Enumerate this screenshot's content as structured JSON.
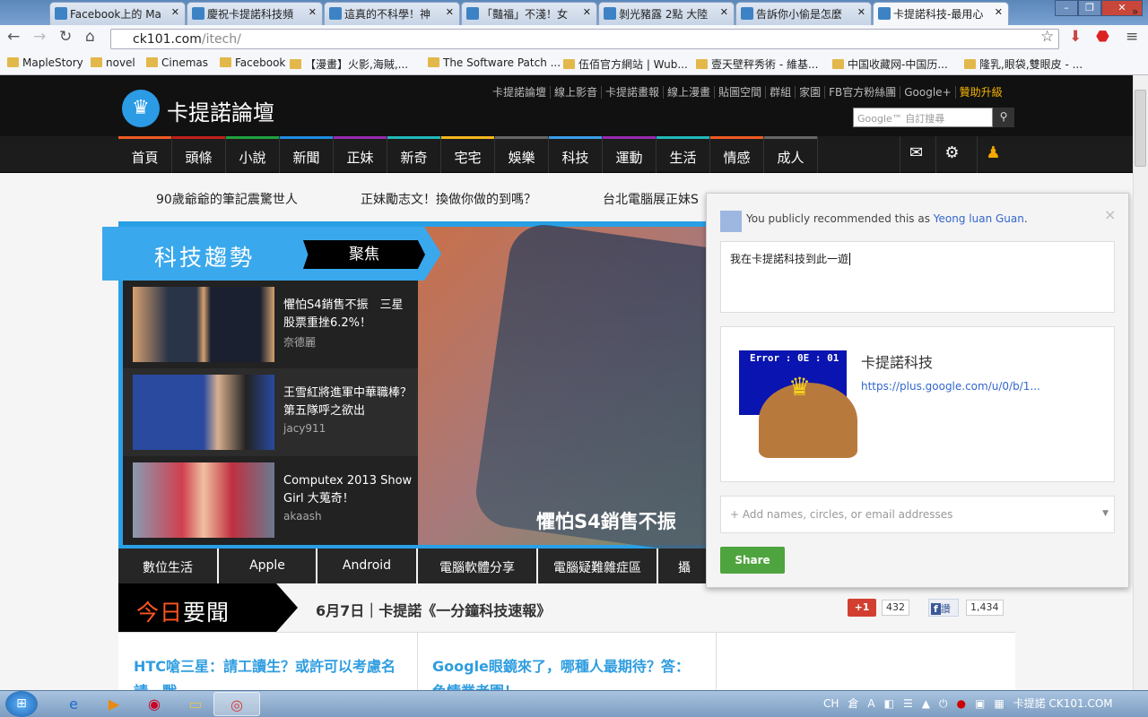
{
  "browser": {
    "tabs": [
      {
        "title": "Facebook上的 Ma",
        "active": false
      },
      {
        "title": "慶祝卡提諾科技頻",
        "active": false
      },
      {
        "title": "這真的不科學！神",
        "active": false
      },
      {
        "title": "「豔福」不淺！女",
        "active": false
      },
      {
        "title": "剝光豬露 2點 大陸",
        "active": false
      },
      {
        "title": "告訴你小偷是怎麼",
        "active": false
      },
      {
        "title": "卡提諾科技-最用心",
        "active": true
      }
    ],
    "url_host": "ck101.com",
    "url_path": "/itech/",
    "bookmarks": [
      "MapleStory",
      "novel",
      "Cinemas",
      "Facebook",
      "【漫畫】火影,海賊,...",
      "The Software Patch ...",
      "伍佰官方網站 | Wub...",
      "壹天壁秤秀術 - 維基...",
      "中国收藏网-中国历...",
      "隆乳,眼袋,雙眼皮 - ..."
    ],
    "more": "»"
  },
  "site": {
    "logo_text": "卡提諾論壇",
    "top_links": [
      "卡提諾論壇",
      "線上影音",
      "卡提諾畫報",
      "線上漫畫",
      "貼圖空間",
      "群組",
      "家園",
      "FB官方粉絲團",
      "Google+"
    ],
    "sponsor_link": "贊助升級",
    "search_placeholder": "Google™ 自訂搜尋",
    "nav": [
      {
        "label": "首頁",
        "color": "#f05a22"
      },
      {
        "label": "頭條",
        "color": "#c0201a"
      },
      {
        "label": "小說",
        "color": "#1fa040"
      },
      {
        "label": "新聞",
        "color": "#1f8ce0"
      },
      {
        "label": "正妹",
        "color": "#9a2ab0"
      },
      {
        "label": "新奇",
        "color": "#22b8b8"
      },
      {
        "label": "宅宅",
        "color": "#f5b71c"
      },
      {
        "label": "娛樂",
        "color": "#666666"
      },
      {
        "label": "科技",
        "color": "#3a9ee8"
      },
      {
        "label": "運動",
        "color": "#9a2ab0"
      },
      {
        "label": "生活",
        "color": "#22b8b8"
      },
      {
        "label": "情感",
        "color": "#f05a22"
      },
      {
        "label": "成人",
        "color": "#666666"
      }
    ],
    "ticker": [
      "90歲爺爺的筆記震驚世人",
      "正妹勵志文！換做你做的到嗎？",
      "台北電腦展正妹S"
    ],
    "feature": {
      "title": "科技趨勢",
      "tag": "聚焦",
      "items": [
        {
          "title": "懼怕S4銷售不振　三星股票重挫6.2%！",
          "author": "奈德麗"
        },
        {
          "title": "王雪紅將進軍中華職棒？第五隊呼之欲出",
          "author": "jacy911"
        },
        {
          "title": "Computex 2013 Show Girl 大蒐奇！",
          "author": "akaash"
        }
      ],
      "hero_caption": "懼怕S4銷售不振"
    },
    "categories": [
      "數位生活",
      "Apple",
      "Android",
      "電腦軟體分享",
      "電腦疑難雜症區",
      "攝"
    ],
    "today": {
      "title_accent": "今日",
      "title_rest": "要聞",
      "headline": "6月7日｜卡提諾《一分鐘科技速報》"
    },
    "gplus_label": "+1",
    "gplus_count": "432",
    "fb_label": "讚",
    "fb_count": "1,434",
    "articles": [
      "HTC嗆三星：請工讀生？或許可以考慮名請一戰",
      "Google眼鏡來了，哪種人最期待？答：色情業者園！"
    ]
  },
  "share_popup": {
    "notice_prefix": "You publicly recommended this as ",
    "user_name": "Yeong luan Guan",
    "notice_suffix": ".",
    "message": "我在卡提諾科技到此一遊",
    "card_title": "卡提諾科技",
    "card_link": "https://plus.google.com/u/0/b/1...",
    "card_image_text": "Error : 0E : 01",
    "to_placeholder": "+ Add names, circles, or email addresses",
    "share_label": "Share",
    "close": "×"
  },
  "taskbar": {
    "lang": "CH",
    "clock_text": "卡提諾 CK101.COM"
  }
}
